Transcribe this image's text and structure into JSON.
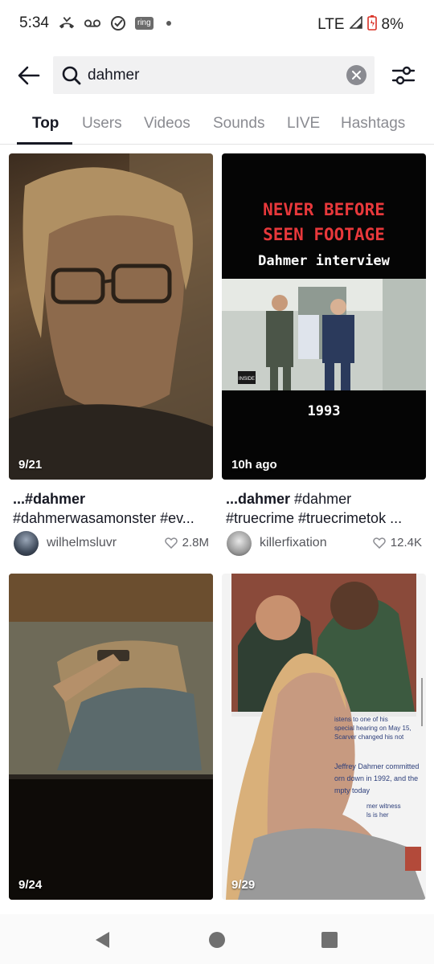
{
  "status_bar": {
    "time": "5:34",
    "ring_label": "ring",
    "network": "LTE",
    "battery": "8%"
  },
  "search": {
    "query": "dahmer"
  },
  "tabs": [
    {
      "label": "Top",
      "active": true
    },
    {
      "label": "Users",
      "active": false
    },
    {
      "label": "Videos",
      "active": false
    },
    {
      "label": "Sounds",
      "active": false
    },
    {
      "label": "LIVE",
      "active": false
    },
    {
      "label": "Hashtags",
      "active": false
    }
  ],
  "results": [
    {
      "thumb_label": "9/21",
      "caption_bold": "...#dahmer",
      "caption_rest": "",
      "caption_line2": "#dahmerwasamonster #ev...",
      "username": "wilhelmsluvr",
      "likes": "2.8M"
    },
    {
      "thumb_label": "10h ago",
      "caption_bold": "...dahmer",
      "caption_rest": " #dahmer",
      "caption_line2": "#truecrime #truecrimetok ...",
      "username": "killerfixation",
      "likes": "12.4K",
      "poster": {
        "line1": "NEVER BEFORE",
        "line2": "SEEN FOOTAGE",
        "line3": "Dahmer interview",
        "year": "1993",
        "badge": "INSIDE EDITION"
      }
    },
    {
      "thumb_label": "9/24"
    },
    {
      "thumb_label": "9/29",
      "overlay_text": [
        "istens to one of his",
        "special hearing on May 15,",
        "Scarver changed his not",
        "Jeffrey Dahmer committed",
        "orn down in 1992, and the",
        "mpty today",
        "mer witness",
        "ls is her"
      ]
    }
  ],
  "colors": {
    "text_primary": "#161823",
    "text_secondary": "#8a8b91",
    "poster_red": "#e8383b",
    "search_bg": "#f1f1f2"
  }
}
